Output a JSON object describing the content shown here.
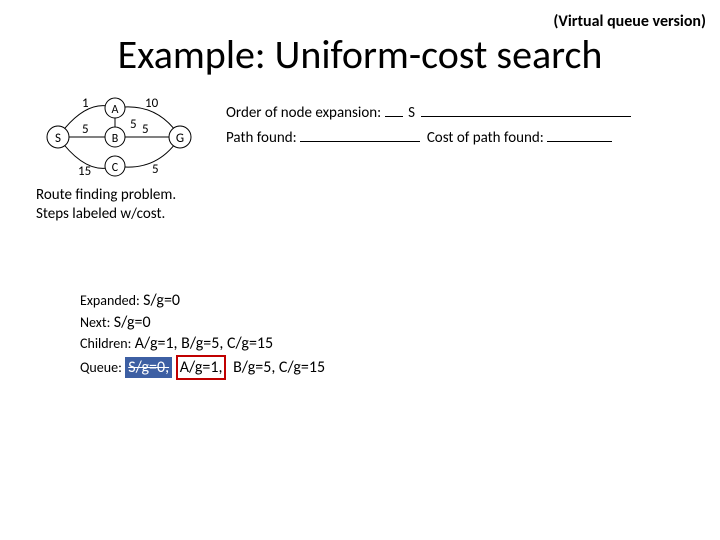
{
  "header": {
    "tag": "(Virtual queue version)",
    "title": "Example: Uniform-cost search"
  },
  "graph": {
    "nodes": {
      "S": "S",
      "A": "A",
      "B": "B",
      "C": "C",
      "G": "G"
    },
    "edges": {
      "SA": "1",
      "SB": "5",
      "SC": "15",
      "AB": "5",
      "AG": "10",
      "BG": "5",
      "CG": "5"
    },
    "caption_l1": "Route finding problem.",
    "caption_l2": "Steps labeled w/cost."
  },
  "right": {
    "order_label": "Order of node expansion:",
    "order_value": "S",
    "path_label": "Path found:",
    "cost_label": "Cost of path found:"
  },
  "trace": {
    "expanded_label": "Expanded:",
    "expanded_value": "S/g=0",
    "next_label": "Next:",
    "next_value": "S/g=0",
    "children_label": "Children:",
    "children_value": "A/g=1, B/g=5, C/g=15",
    "queue_label": "Queue:",
    "queue_items": [
      "S/g=0,",
      "A/g=1,",
      "B/g=5, C/g=15"
    ]
  },
  "chart_data": {
    "type": "graph",
    "title": "Uniform-cost search example",
    "nodes": [
      "S",
      "A",
      "B",
      "C",
      "G"
    ],
    "start": "S",
    "goal": "G",
    "edges": [
      {
        "from": "S",
        "to": "A",
        "cost": 1
      },
      {
        "from": "S",
        "to": "B",
        "cost": 5
      },
      {
        "from": "S",
        "to": "C",
        "cost": 15
      },
      {
        "from": "A",
        "to": "B",
        "cost": 5
      },
      {
        "from": "A",
        "to": "G",
        "cost": 10
      },
      {
        "from": "B",
        "to": "G",
        "cost": 5
      },
      {
        "from": "C",
        "to": "G",
        "cost": 5
      }
    ],
    "expansion_order_shown": [
      "S"
    ],
    "queue_snapshot": [
      {
        "node": "S",
        "g": 0,
        "status": "expanded"
      },
      {
        "node": "A",
        "g": 1,
        "status": "next"
      },
      {
        "node": "B",
        "g": 5,
        "status": "open"
      },
      {
        "node": "C",
        "g": 15,
        "status": "open"
      }
    ]
  }
}
